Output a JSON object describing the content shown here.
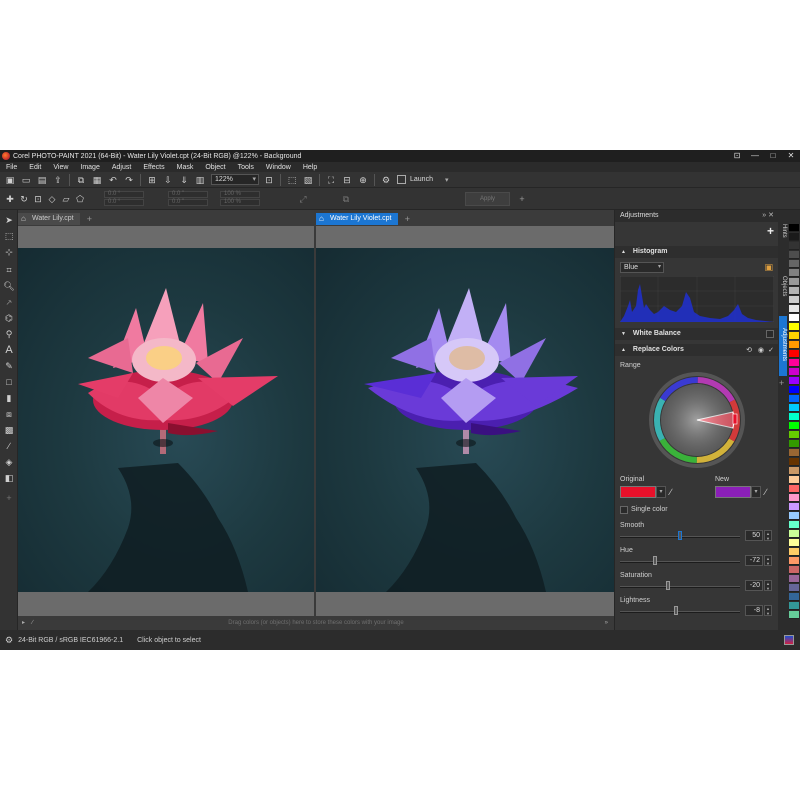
{
  "window": {
    "title": "Corel PHOTO-PAINT 2021 (64-Bit) - Water Lily Violet.cpt (24-Bit RGB) @122% - Background",
    "controls": [
      "⊡",
      "—",
      "□",
      "✕"
    ]
  },
  "menu": [
    "File",
    "Edit",
    "View",
    "Image",
    "Adjust",
    "Effects",
    "Mask",
    "Object",
    "Tools",
    "Window",
    "Help"
  ],
  "toolbar": {
    "zoom": "122%",
    "launch_label": "Launch"
  },
  "property_bar": {
    "fields": [
      "0.0 °",
      "0.0 °",
      "0.0 \"",
      "100 %",
      "0.0 \"",
      "100 %"
    ],
    "apply_label": "Apply"
  },
  "documents": [
    {
      "tab": "Water Lily.cpt",
      "active": false
    },
    {
      "tab": "Water Lily Violet.cpt",
      "active": true
    }
  ],
  "palette_hint": "Drag colors (or objects) here to store these colors with your image",
  "status": {
    "color_profile": "24-Bit RGB / sRGB IEC61966-2.1",
    "hint": "Click object to select"
  },
  "adjustments_panel": {
    "title": "Adjustments",
    "histogram": {
      "label": "Histogram",
      "channel": "Blue",
      "color": "#2030c8"
    },
    "white_balance_label": "White Balance",
    "replace_colors": {
      "label": "Replace Colors",
      "range_label": "Range",
      "original_label": "Original",
      "original_color": "#e8102a",
      "new_label": "New",
      "new_color": "#8b1fb8",
      "single_color_label": "Single color",
      "sliders": [
        {
          "label": "Smooth",
          "value": "50",
          "level": 0.5
        },
        {
          "label": "Hue",
          "value": "-72",
          "level": 0.15
        },
        {
          "label": "Saturation",
          "value": "-20",
          "level": 0.4
        },
        {
          "label": "Lightness",
          "value": "-8",
          "level": 0.46
        }
      ]
    }
  },
  "dock_tabs": [
    "Hints",
    "Objects",
    "Adjustments"
  ],
  "palette_colors": [
    "#000000",
    "#1a1a1a",
    "#333333",
    "#4d4d4d",
    "#666666",
    "#808080",
    "#999999",
    "#b3b3b3",
    "#cccccc",
    "#e6e6e6",
    "#ffffff",
    "#ffff00",
    "#ffd400",
    "#ff9900",
    "#ff0000",
    "#ff0099",
    "#cc00cc",
    "#9900ff",
    "#0000ff",
    "#0066ff",
    "#00ccff",
    "#00ffcc",
    "#00ff00",
    "#66cc00",
    "#339900",
    "#996633",
    "#663300",
    "#cc9966",
    "#ffcc99",
    "#ff6666",
    "#ff99cc",
    "#cc99ff",
    "#99ccff",
    "#66ffcc",
    "#ccff99",
    "#ffff99",
    "#ffcc66",
    "#ff9966",
    "#cc6666",
    "#996699",
    "#666699",
    "#336699",
    "#339999",
    "#66cc99"
  ]
}
